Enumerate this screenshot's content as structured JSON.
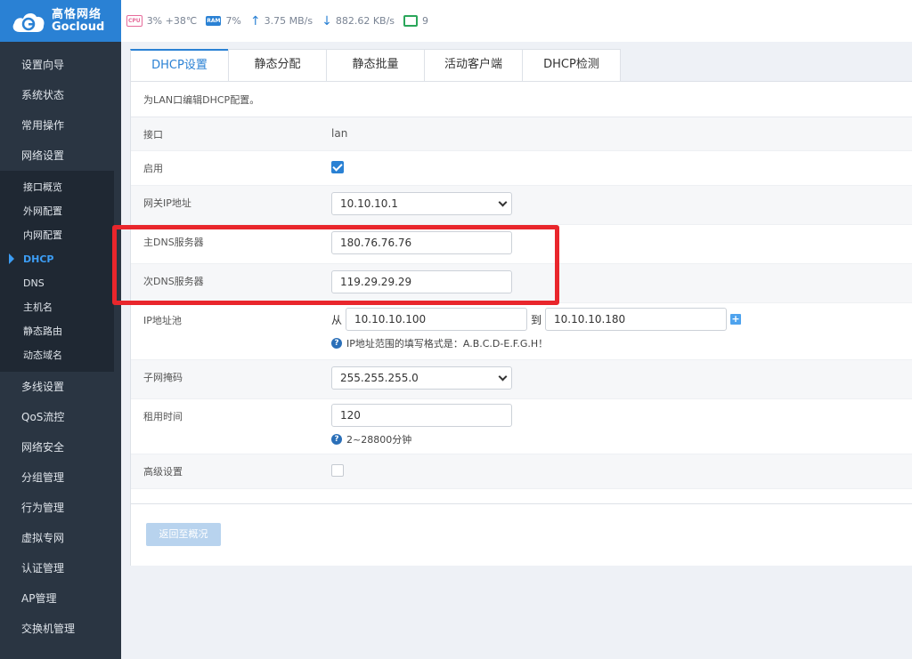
{
  "logo": {
    "cn": "高恪网络",
    "en": "Gocloud"
  },
  "topbar": {
    "cpu_badge": "CPU",
    "cpu": "3% +38℃",
    "ram_badge": "RAM",
    "ram": "7%",
    "upload": "3.75 MB/s",
    "download": "882.62 KB/s",
    "clients": "9"
  },
  "sidebar": {
    "items_top": [
      "设置向导",
      "系统状态",
      "常用操作",
      "网络设置"
    ],
    "sub_items": [
      "接口概览",
      "外网配置",
      "内网配置",
      "DHCP",
      "DNS",
      "主机名",
      "静态路由",
      "动态域名"
    ],
    "active_sub": "DHCP",
    "items_bottom": [
      "多线设置",
      "QoS流控",
      "网络安全",
      "分组管理",
      "行为管理",
      "虚拟专网",
      "认证管理",
      "AP管理",
      "交换机管理"
    ]
  },
  "tabs": [
    "DHCP设置",
    "静态分配",
    "静态批量",
    "活动客户端",
    "DHCP检测"
  ],
  "active_tab": "DHCP设置",
  "form": {
    "description": "为LAN口编辑DHCP配置。",
    "interface_label": "接口",
    "interface_value": "lan",
    "enable_label": "启用",
    "enable_checked": true,
    "gateway_label": "网关IP地址",
    "gateway_value": "10.10.10.1",
    "dns1_label": "主DNS服务器",
    "dns1_value": "180.76.76.76",
    "dns2_label": "次DNS服务器",
    "dns2_value": "119.29.29.29",
    "pool_label": "IP地址池",
    "pool_from_label": "从",
    "pool_from": "10.10.10.100",
    "pool_to_label": "到",
    "pool_to": "10.10.10.180",
    "pool_hint": "IP地址范围的填写格式是：A.B.C.D-E.F.G.H！",
    "mask_label": "子网掩码",
    "mask_value": "255.255.255.0",
    "lease_label": "租用时间",
    "lease_value": "120",
    "lease_hint": "2~28800分钟",
    "advanced_label": "高级设置",
    "advanced_checked": false
  },
  "back_button": "返回至概况",
  "colors": {
    "accent": "#2a81d4",
    "sidebar": "#2a3542",
    "highlight": "#e9262c"
  }
}
